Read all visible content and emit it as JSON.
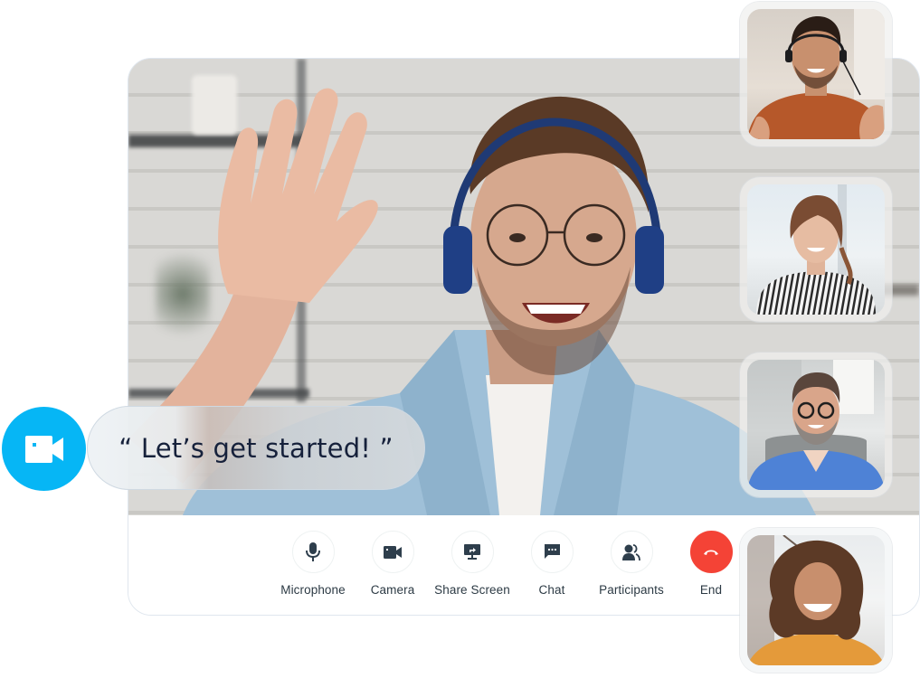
{
  "main_video": {
    "participant": "presenter-waving",
    "description": "Man with glasses and blue headphones waving"
  },
  "callout": {
    "icon": "video-camera-icon",
    "message": "“ Let’s get started! ”",
    "badge_color": "#06B6F5"
  },
  "controls": [
    {
      "id": "microphone",
      "label": "Microphone",
      "icon": "microphone-icon"
    },
    {
      "id": "camera",
      "label": "Camera",
      "icon": "video-camera-icon"
    },
    {
      "id": "share-screen",
      "label": "Share Screen",
      "icon": "share-screen-icon"
    },
    {
      "id": "chat",
      "label": "Chat",
      "icon": "chat-bubble-icon"
    },
    {
      "id": "participants",
      "label": "Participants",
      "icon": "participants-icon"
    },
    {
      "id": "end",
      "label": "End",
      "icon": "hang-up-icon",
      "color": "#F44336"
    }
  ],
  "participants": [
    {
      "id": "participant-1",
      "description": "Man with headset in orange shirt"
    },
    {
      "id": "participant-2",
      "description": "Woman in striped shirt"
    },
    {
      "id": "participant-3",
      "description": "Older man with glasses in blue shirt"
    },
    {
      "id": "participant-4",
      "description": "Woman with curly hair in orange top"
    }
  ],
  "colors": {
    "icon": "#2E3E4C",
    "label": "#2C3A44",
    "end_button": "#F44336",
    "accent": "#06B6F5",
    "callout_text": "#16213B"
  }
}
